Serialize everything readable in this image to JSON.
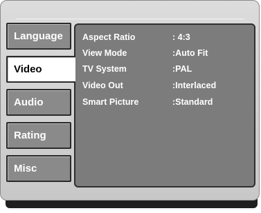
{
  "tabs": [
    {
      "label": "Language",
      "active": false
    },
    {
      "label": "Video",
      "active": true
    },
    {
      "label": "Audio",
      "active": false
    },
    {
      "label": "Rating",
      "active": false
    },
    {
      "label": "Misc",
      "active": false
    }
  ],
  "settings": [
    {
      "label": "Aspect Ratio",
      "value": ": 4:3"
    },
    {
      "label": "View Mode",
      "value": ":Auto Fit"
    },
    {
      "label": "TV System",
      "value": ":PAL"
    },
    {
      "label": "Video Out",
      "value": ":Interlaced"
    },
    {
      "label": "Smart Picture",
      "value": ":Standard"
    }
  ],
  "colors": {
    "panel": "#d0d0d0",
    "tab_inactive": "#8a8a8a",
    "tab_active": "#ffffff",
    "content_bg": "#7c7c7c",
    "text": "#ffffff"
  }
}
